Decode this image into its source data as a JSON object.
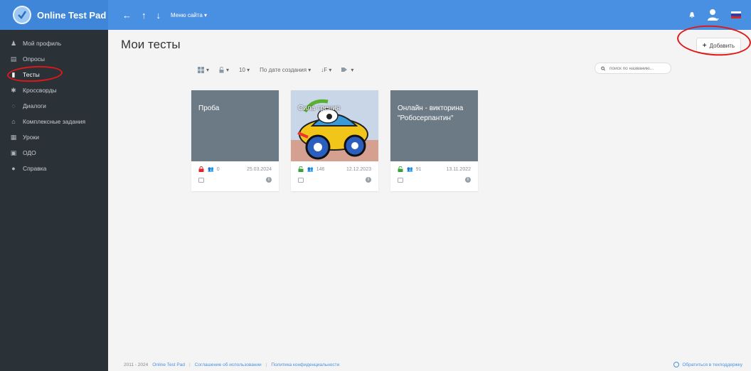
{
  "topbar": {
    "brand": "Online Test Pad",
    "nav": {
      "back": "←",
      "up": "↑",
      "down": "↓",
      "menu": "Меню сайта ▾"
    },
    "colors": {
      "bar": "#4a90e2",
      "brand": "#3f86d8"
    }
  },
  "sidebar": {
    "items": [
      {
        "icon": "user-icon",
        "glyph": "♟",
        "label": "Мой профиль"
      },
      {
        "icon": "poll-icon",
        "glyph": "▤",
        "label": "Опросы"
      },
      {
        "icon": "tests-icon",
        "glyph": "▮",
        "label": "Тесты",
        "active": true
      },
      {
        "icon": "crossword-icon",
        "glyph": "✱",
        "label": "Кроссворды"
      },
      {
        "icon": "dialog-icon",
        "glyph": "◌",
        "label": "Диалоги"
      },
      {
        "icon": "complex-icon",
        "glyph": "⌂",
        "label": "Комплексные задания"
      },
      {
        "icon": "lessons-icon",
        "glyph": "▦",
        "label": "Уроки"
      },
      {
        "icon": "odo-icon",
        "glyph": "▣",
        "label": "ОДО"
      },
      {
        "icon": "help-icon",
        "glyph": "●",
        "label": "Справка"
      }
    ]
  },
  "main": {
    "title": "Мои тесты",
    "add_label": "Добавить",
    "toolbar": {
      "view": "▾",
      "access": "▾",
      "per_page": "10 ▾",
      "sort": "По дате создания ▾",
      "sort_dir": "↓F ▾",
      "tags": "▾"
    },
    "search_placeholder": "поиск по названию...",
    "cards": [
      {
        "title": "Проба",
        "locked": true,
        "users": "0",
        "date": "25.03.2024",
        "has_image": false
      },
      {
        "title": "Сила трения",
        "locked": false,
        "users": "146",
        "date": "12.12.2023",
        "has_image": true
      },
      {
        "title": "Онлайн - викторина \"Робосерпантин\"",
        "locked": false,
        "users": "91",
        "date": "13.11.2022",
        "has_image": false
      }
    ]
  },
  "footer": {
    "years": "2011 - 2024",
    "brand_link": "Online Test Pad",
    "sep": "|",
    "terms": "Соглашение об использовании",
    "privacy": "Политика конфиденциальности",
    "support": "Обратиться в техподдержку"
  }
}
